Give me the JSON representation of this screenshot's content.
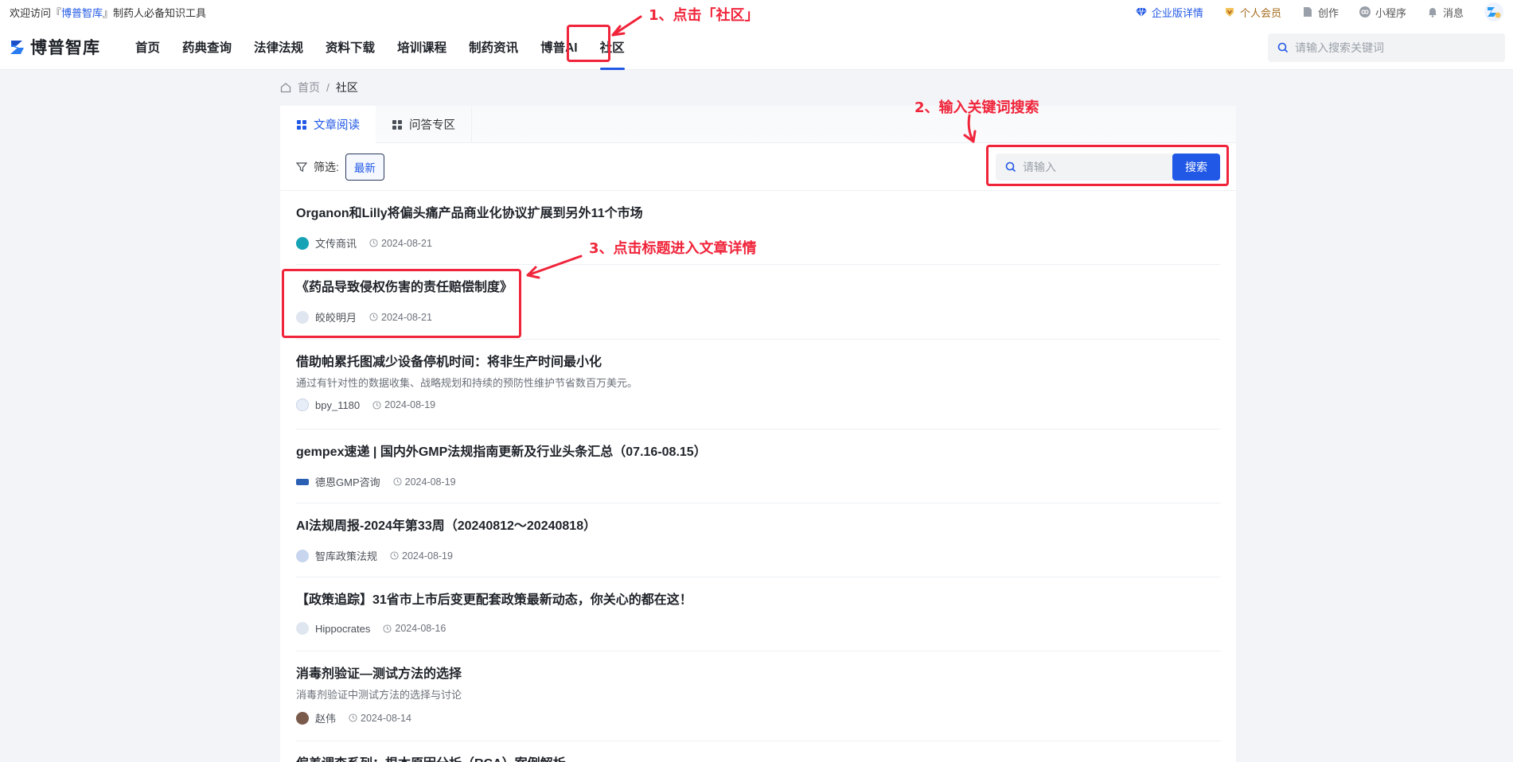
{
  "topbar": {
    "welcome_prefix": "欢迎访问『",
    "welcome_brand": "博普智库",
    "welcome_suffix": "』制药人必备知识工具",
    "enterprise": "企业版详情",
    "vip": "个人会员",
    "create": "创作",
    "miniapp": "小程序",
    "message": "消息"
  },
  "nav": {
    "logo": "博普智库",
    "items": [
      "首页",
      "药典查询",
      "法律法规",
      "资料下载",
      "培训课程",
      "制药资讯",
      "博普AI",
      "社区"
    ],
    "active_index": 7,
    "search_placeholder": "请输入搜索关键词"
  },
  "breadcrumb": {
    "home": "首页",
    "sep": "/",
    "current": "社区"
  },
  "tabs": [
    {
      "label": "文章阅读",
      "active": true
    },
    {
      "label": "问答专区",
      "active": false
    }
  ],
  "filter": {
    "label": "筛选:",
    "chip": "最新",
    "search_placeholder": "请输入",
    "search_button": "搜索"
  },
  "articles": [
    {
      "title": "Organon和Lilly将偏头痛产品商业化协议扩展到另外11个市场",
      "desc": "",
      "author": "文传商讯",
      "date": "2024-08-21"
    },
    {
      "title": "《药品导致侵权伤害的责任赔偿制度》",
      "desc": "",
      "author": "皎皎明月",
      "date": "2024-08-21"
    },
    {
      "title": "借助帕累托图减少设备停机时间：将非生产时间最小化",
      "desc": "通过有针对性的数据收集、战略规划和持续的预防性维护节省数百万美元。",
      "author": "bpy_1180",
      "date": "2024-08-19"
    },
    {
      "title": "gempex速递 | 国内外GMP法规指南更新及行业头条汇总（07.16-08.15）",
      "desc": "",
      "author": "德恩GMP咨询",
      "date": "2024-08-19"
    },
    {
      "title": "AI法规周报-2024年第33周（20240812～20240818）",
      "desc": "",
      "author": "智库政策法规",
      "date": "2024-08-19"
    },
    {
      "title": "【政策追踪】31省市上市后变更配套政策最新动态，你关心的都在这！",
      "desc": "",
      "author": "Hippocrates",
      "date": "2024-08-16"
    },
    {
      "title": "消毒剂验证—测试方法的选择",
      "desc": "消毒剂验证中测试方法的选择与讨论",
      "author": "赵伟",
      "date": "2024-08-14"
    },
    {
      "title": "偏差调查系列：根本原因分析（RCA）案例解析",
      "desc": "",
      "author": "",
      "date": ""
    }
  ],
  "annotations": {
    "step1": "1、点击「社区」",
    "step2": "2、输入关键词搜索",
    "step3": "3、点击标题进入文章详情"
  },
  "colors": {
    "accent": "#2158e5",
    "annotation": "#f0243a"
  }
}
